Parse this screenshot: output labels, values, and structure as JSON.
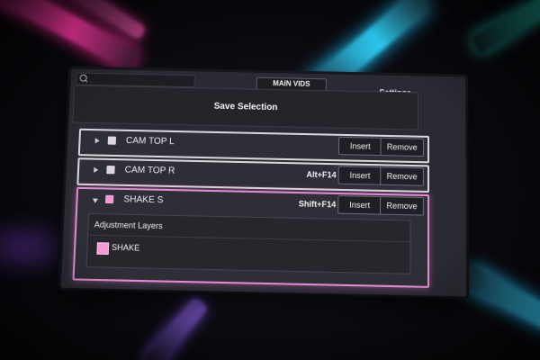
{
  "search": {
    "icon": "search-icon",
    "value": "",
    "placeholder": ""
  },
  "tabs": {
    "main": "MAIN VIDS"
  },
  "settings": {
    "label": "Settings"
  },
  "save": {
    "label": "Save Selection"
  },
  "rows": [
    {
      "label": "CAM TOP L",
      "shortcut": "",
      "expanded": false,
      "swatch_color": "#dcd6de",
      "insert": "Insert",
      "remove": "Remove"
    },
    {
      "label": "CAM TOP R",
      "shortcut": "Alt+F14",
      "expanded": false,
      "swatch_color": "#dcd6de",
      "insert": "Insert",
      "remove": "Remove"
    },
    {
      "label": "SHAKE S",
      "shortcut": "Shift+F14",
      "expanded": true,
      "swatch_color": "#f39ad4",
      "insert": "Insert",
      "remove": "Remove"
    }
  ],
  "adjustment": {
    "title": "Adjustment Layers",
    "items": [
      {
        "label": "SHAKE",
        "swatch_color": "#f39ad4"
      }
    ]
  },
  "colors": {
    "selected_border": "#e08ad0",
    "row_border": "#d8d8dc",
    "neon_pink": "#ff3aa6",
    "neon_cyan": "#2fd6ff"
  }
}
